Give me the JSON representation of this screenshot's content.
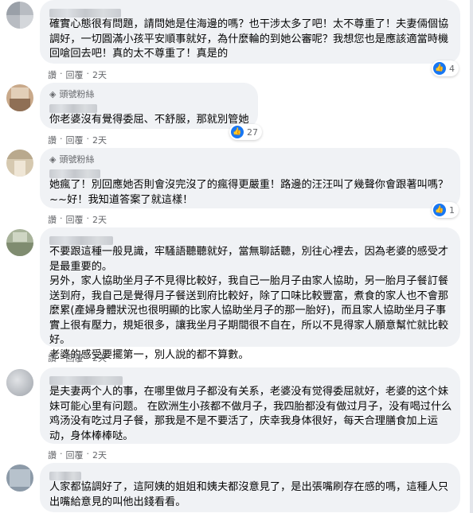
{
  "actions": {
    "like": "讚",
    "dot": "·",
    "reply": "回覆",
    "time": "2天"
  },
  "badge_label": "頭號粉絲",
  "comments": [
    {
      "text": "確實心態很有問題，請問她是住海邊的嗎？也干涉太多了吧！太不尊重了！夫妻倆個協調好，一切圓滿小孩平安順事就好，為什麼輪的到她公審呢？我想您也是應該適當時機回嗆回去吧！真的太不尊重了！真是的",
      "reactions": "4"
    },
    {
      "text": "你老婆沒有覺得委屈、不舒服，那就別管她",
      "reactions": "27"
    },
    {
      "text": "她瘋了！別回應她否則會沒完沒了的瘋得更嚴重！路邊的汪汪叫了幾聲你會跟著叫嗎？~~好！我知道答案了就這樣！",
      "reactions": "1"
    },
    {
      "text": "不要跟這種一般見識，牢騷語聽聽就好，當無聊話聽，別往心裡去，因為老婆的感受才是最重要的。\n另外，家人協助坐月子不見得比較好，我自己一胎月子由家人協助，另一胎月子餐訂餐送到府，我自己是覺得月子餐送到府比較好，除了口味比較豐富，煮食的家人也不會那麼累(產婦身體狀況也很明顯的比家人協助坐月子的那一胎好)，而且家人協助坐月子事實上很有壓力，規矩很多，讓我坐月子期間很不自在，所以不見得家人願意幫忙就比較好。\n老婆的感受要擺第一，別人說的都不算數。"
    },
    {
      "text": "是夫妻两个人的事，在哪里做月子都没有关系，老婆没有觉得委屈就好，老婆的这个妹妹可能心里有问题。 在欧洲生小孩都不做月子，我四胎都没有做过月子，没有喝过什么鸡汤没有吃过月子餐，那我是不是不要活了，庆幸我身体很好，每天合理膳食加上运动，身体棒棒哒。"
    },
    {
      "text": "人家都協調好了，這阿姨的姐姐和姨夫都沒意見了，是出張嘴刷存在感的嗎，這種人只出嘴給意見的叫他出錢看看。"
    }
  ]
}
